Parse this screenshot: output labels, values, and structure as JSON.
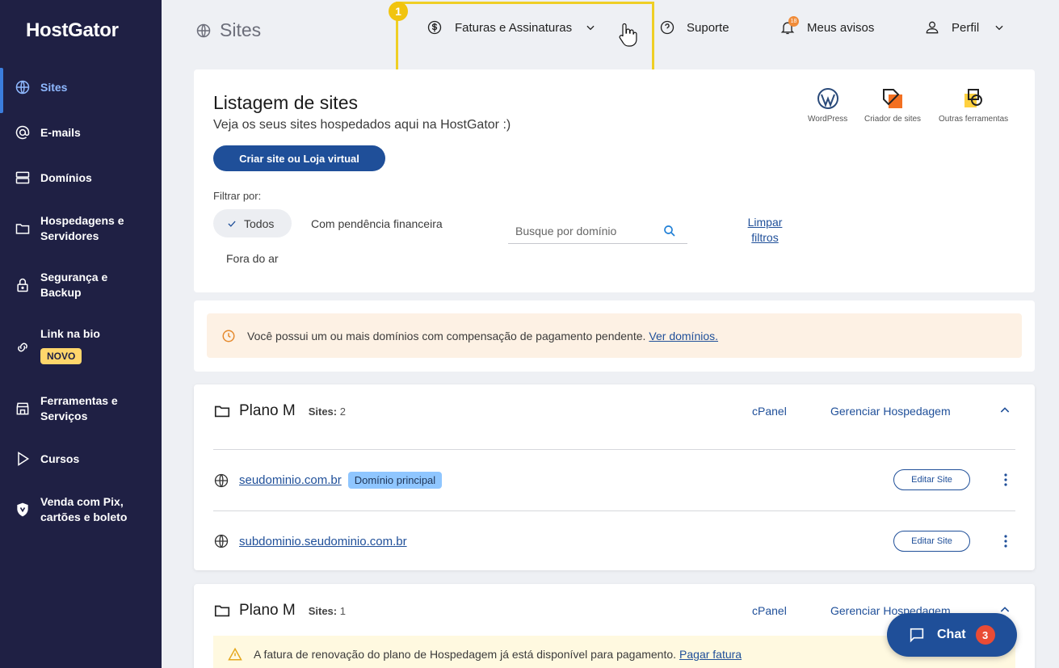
{
  "brand": "HostGator",
  "sidebar": {
    "items": [
      {
        "label": "Sites",
        "icon": "globe-icon"
      },
      {
        "label": "E-mails",
        "icon": "at-icon"
      },
      {
        "label": "Domínios",
        "icon": "server-icon"
      },
      {
        "label": "Hospedagens e Servidores",
        "icon": "folder-icon"
      },
      {
        "label": "Segurança e Backup",
        "icon": "lock-icon"
      },
      {
        "label": "Link na bio",
        "icon": "link-icon",
        "badge": "NOVO"
      },
      {
        "label": "Ferramentas e Serviços",
        "icon": "store-icon"
      },
      {
        "label": "Cursos",
        "icon": "play-icon"
      },
      {
        "label": "Venda com Pix, cartões e boleto",
        "icon": "shield-icon"
      }
    ]
  },
  "header": {
    "title": "Sites",
    "billing": "Faturas e Assinaturas",
    "support": "Suporte",
    "notices": "Meus avisos",
    "notices_count": "18",
    "profile": "Perfil",
    "step": "1"
  },
  "main": {
    "title": "Listagem de sites",
    "subtitle": "Veja os seus sites hospedados aqui na HostGator :)",
    "create_button": "Criar site ou Loja virtual",
    "filter_label": "Filtrar por:",
    "filters": [
      "Todos",
      "Com pendência financeira",
      "Fora do ar"
    ],
    "search_placeholder": "Busque por domínio",
    "clear_filters": "Limpar filtros",
    "tools": [
      "WordPress",
      "Criador de sites",
      "Outras ferramentas"
    ]
  },
  "alert": {
    "text": "Você possui um ou mais domínios com compensação de pagamento pendente.",
    "link": "Ver domínios."
  },
  "plans": [
    {
      "name": "Plano M",
      "sites_label": "Sites:",
      "sites_count": "2",
      "cpanel": "cPanel",
      "manage": "Gerenciar Hospedagem",
      "sites": [
        {
          "domain": "seudominio.com.br",
          "tag": "Domínio principal",
          "edit": "Editar Site"
        },
        {
          "domain": "subdominio.seudominio.com.br",
          "edit": "Editar Site"
        }
      ]
    },
    {
      "name": "Plano M",
      "sites_label": "Sites:",
      "sites_count": "1",
      "cpanel": "cPanel",
      "manage": "Gerenciar Hospedagem",
      "notice": "A fatura de renovação do plano de Hospedagem já está disponível para pagamento.",
      "notice_link": "Pagar fatura"
    }
  ],
  "chat": {
    "label": "Chat",
    "count": "3"
  },
  "colors": {
    "sidebar": "#1f2044",
    "primary": "#1f4f99",
    "highlight": "#efcf25",
    "warning_bg": "#fdf1e4"
  }
}
